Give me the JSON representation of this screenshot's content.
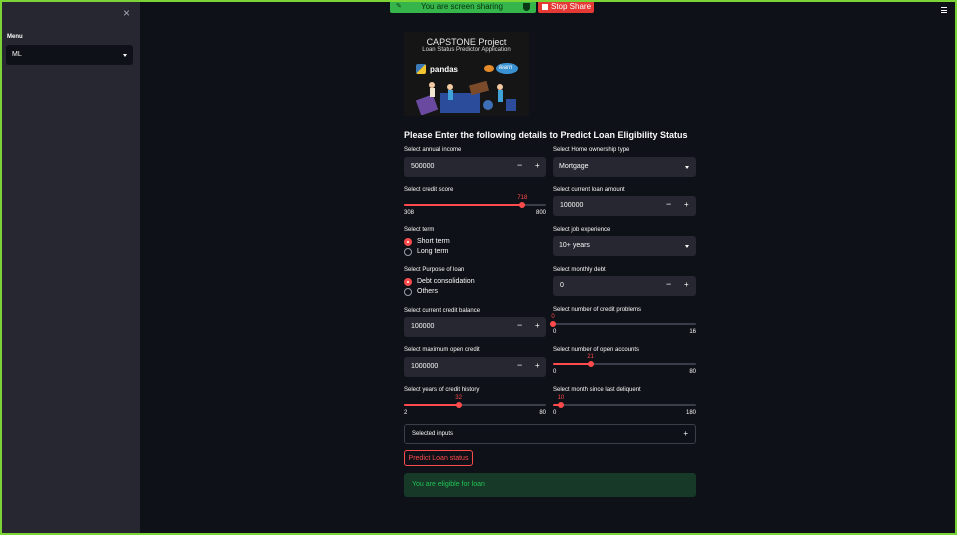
{
  "share_bar": {
    "text": "You are screen sharing",
    "stop_label": "Stop Share"
  },
  "sidebar": {
    "close_glyph": "×",
    "menu_label": "Menu",
    "menu_value": "ML"
  },
  "banner": {
    "title": "CAPSTONE Project",
    "subtitle": "Loan Status Predictor Application",
    "lib1": "pandas",
    "lib2": "learn"
  },
  "heading": "Please Enter the following details to Predict Loan Eligibility Status",
  "left": {
    "income": {
      "label": "Select annual income",
      "value": "500000"
    },
    "credit_score": {
      "label": "Select credit score",
      "value": 718,
      "min": 308,
      "max": 800
    },
    "term": {
      "label": "Select term",
      "options": [
        "Short term",
        "Long term"
      ],
      "selected": "Short term"
    },
    "purpose": {
      "label": "Select Purpose of loan",
      "options": [
        "Debt consolidation",
        "Others"
      ],
      "selected": "Debt consolidation"
    },
    "balance": {
      "label": "Select current credit balance",
      "value": "100000"
    },
    "max_credit": {
      "label": "Select maximum open credit",
      "value": "1000000"
    },
    "history": {
      "label": "Select years of credit history",
      "value": 32,
      "min": 2,
      "max": 80
    }
  },
  "right": {
    "home": {
      "label": "Select Home ownership type",
      "value": "Mortgage"
    },
    "loan_amount": {
      "label": "Select current loan amount",
      "value": "100000"
    },
    "job": {
      "label": "Select job experience",
      "value": "10+ years"
    },
    "monthly_debt": {
      "label": "Select monthly debt",
      "value": "0"
    },
    "credit_problems": {
      "label": "Select number of credit problems",
      "value": 0,
      "min": 0,
      "max": 16
    },
    "open_accounts": {
      "label": "Select number of open accounts",
      "value": 21,
      "min": 0,
      "max": 80
    },
    "delinquent": {
      "label": "Select month since last deliquent",
      "value": 10,
      "min": 0,
      "max": 180
    }
  },
  "expander_label": "Selected inputs",
  "predict_label": "Predict Loan status",
  "result": "You are eligible for loan",
  "colors": {
    "accent": "#ff4b4b",
    "success_text": "#21c354",
    "bg": "#0e1117",
    "sidebar": "#262730"
  }
}
